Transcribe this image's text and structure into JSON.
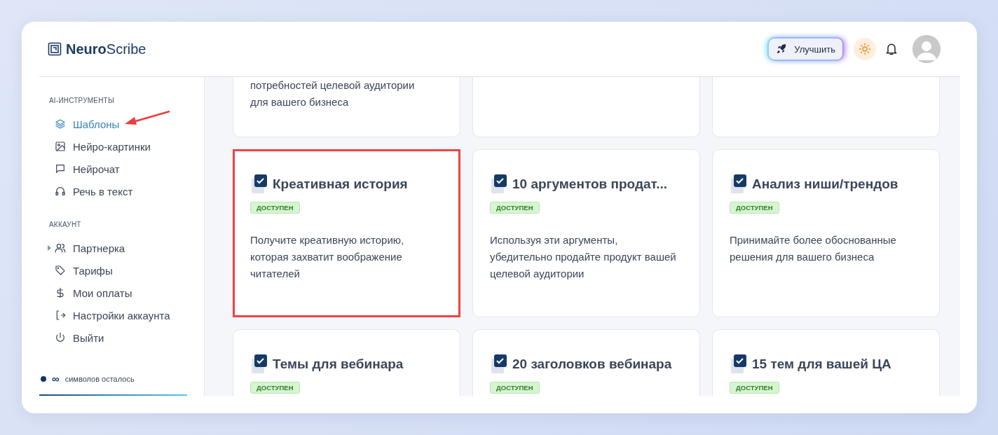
{
  "header": {
    "logo": {
      "bold": "Neuro",
      "light": "Scribe"
    },
    "upgrade_button": "Улучшить"
  },
  "sidebar": {
    "sections": [
      {
        "title": "AI-ИНСТРУМЕНТЫ",
        "items": [
          {
            "label": "Шаблоны",
            "selected": true,
            "arrow": true
          },
          {
            "label": "Нейро-картинки",
            "selected": false,
            "arrow": false
          },
          {
            "label": "Нейрочат",
            "selected": false,
            "arrow": false
          },
          {
            "label": "Речь в текст",
            "selected": false,
            "arrow": false
          }
        ]
      },
      {
        "title": "АККАУНТ",
        "items": [
          {
            "label": "Партнерка",
            "selected": false,
            "arrow": false,
            "expandable": true
          },
          {
            "label": "Тарифы",
            "selected": false,
            "arrow": false
          },
          {
            "label": "Мои оплаты",
            "selected": false,
            "arrow": false
          },
          {
            "label": "Настройки аккаунта",
            "selected": false,
            "arrow": false
          },
          {
            "label": "Выйти",
            "selected": false,
            "arrow": false
          }
        ]
      }
    ],
    "credits": {
      "amount": "∞",
      "label": "символов осталось"
    }
  },
  "cards": [
    {
      "kind": "partial",
      "lines": [
        "потребностей целевой аудитории",
        "для вашего бизнеса"
      ],
      "highlighted": false
    },
    {
      "kind": "partial",
      "highlighted": false
    },
    {
      "kind": "partial",
      "highlighted": false
    },
    {
      "kind": "full",
      "title": "Креативная история",
      "badge": "ДОСТУПЕН",
      "description": "Получите креативную историю, которая захватит воображение читателей",
      "highlighted": true
    },
    {
      "kind": "full",
      "title": "10 аргументов продат...",
      "badge": "ДОСТУПЕН",
      "description": "Используя эти аргументы, убедительно продайте продукт вашей целевой аудитории",
      "highlighted": false
    },
    {
      "kind": "full",
      "title": "Анализ ниши/трендов",
      "badge": "ДОСТУПЕН",
      "description": "Принимайте более обоснованные решения для вашего бизнеса",
      "highlighted": false
    },
    {
      "kind": "cut",
      "title": "Темы для вебинара",
      "badge": "ДОСТУПЕН",
      "highlighted": false
    },
    {
      "kind": "cut",
      "title": "20 заголовков вебинара",
      "badge": "ДОСТУПЕН",
      "highlighted": false
    },
    {
      "kind": "cut",
      "title": "15 тем для вашей ЦА",
      "badge": "ДОСТУПЕН",
      "highlighted": false
    }
  ]
}
